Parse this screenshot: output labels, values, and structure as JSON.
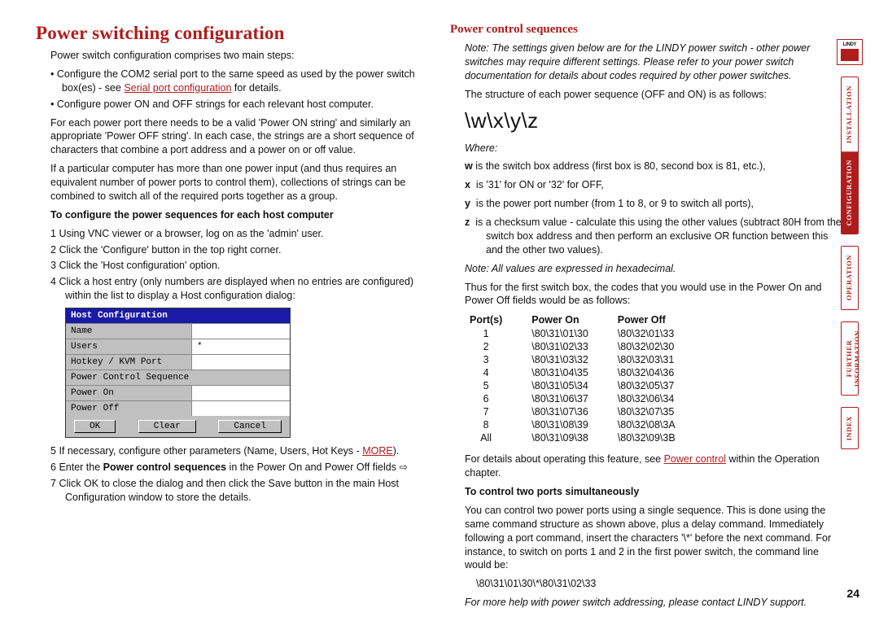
{
  "left": {
    "h1": "Power switching configuration",
    "intro": "Power switch configuration comprises two main steps:",
    "b1a": "Configure the COM2 serial port to the same speed as used by the power switch box(es) - see ",
    "b1_link": "Serial port configuration",
    "b1b": " for details.",
    "b2": "Configure power ON and OFF strings for each relevant host computer.",
    "p1": "For each power port there needs to be a valid 'Power ON string' and similarly an appropriate 'Power OFF string'. In each case, the strings are a short sequence of characters that combine a port address and a power on or off value.",
    "p2": "If a particular computer has more than one power input (and thus requires an equivalent number of power ports to control them), collections of strings can be combined to switch all of the required ports together as a group.",
    "sh1": "To configure the power sequences for each host computer",
    "s1": "Using VNC viewer or a browser, log on as the 'admin' user.",
    "s2": "Click the 'Configure' button in the top right corner.",
    "s3": "Click the 'Host configuration' option.",
    "s4": "Click a host entry (only numbers are displayed when no entries are configured) within the list to display a Host configuration dialog:",
    "dlg": {
      "title": "Host Configuration",
      "r1": "Name",
      "r2": "Users",
      "v2": "*",
      "r3": "Hotkey / KVM Port",
      "r4": "Power Control Sequence",
      "r5": "Power On",
      "r6": "Power Off",
      "ok": "OK",
      "clear": "Clear",
      "cancel": "Cancel"
    },
    "s5a": "If necessary, configure other parameters (Name, Users, Hot Keys - ",
    "s5_link": "MORE",
    "s5b": ").",
    "s6a": "Enter the ",
    "s6_strong": "Power control sequences",
    "s6b": " in the Power On and Power Off fields ⇨",
    "s7": "Click OK to close the dialog and then click the Save button in the main Host Configuration window to store the details."
  },
  "right": {
    "h2": "Power control sequences",
    "note1": "Note: The settings given below are for the LINDY power switch - other power switches may require different settings. Please refer to your power switch documentation for details about codes required by other power switches.",
    "p1": "The structure of each power sequence (OFF and ON) is as follows:",
    "seq": "\\w\\x\\y\\z",
    "where": "Where:",
    "d_w": " is the switch box address (first box is 80, second box is 81, etc.),",
    "d_x": " is '31' for ON or '32' for OFF,",
    "d_y": " is the power port number (from 1 to 8, or 9 to switch all ports),",
    "d_z": " is a checksum value - calculate this using the other values (subtract 80H from the switch box address and then perform an exclusive OR function between this and the other two values).",
    "note2": "Note: All values are expressed in hexadecimal.",
    "p2": "Thus for the first switch box, the codes that you would use in the Power On and Power Off fields would be as follows:",
    "th1": "Port(s)",
    "th2": "Power On",
    "th3": "Power Off",
    "rows": [
      {
        "p": "1",
        "on": "\\80\\31\\01\\30",
        "off": "\\80\\32\\01\\33"
      },
      {
        "p": "2",
        "on": "\\80\\31\\02\\33",
        "off": "\\80\\32\\02\\30"
      },
      {
        "p": "3",
        "on": "\\80\\31\\03\\32",
        "off": "\\80\\32\\03\\31"
      },
      {
        "p": "4",
        "on": "\\80\\31\\04\\35",
        "off": "\\80\\32\\04\\36"
      },
      {
        "p": "5",
        "on": "\\80\\31\\05\\34",
        "off": "\\80\\32\\05\\37"
      },
      {
        "p": "6",
        "on": "\\80\\31\\06\\37",
        "off": "\\80\\32\\06\\34"
      },
      {
        "p": "7",
        "on": "\\80\\31\\07\\36",
        "off": "\\80\\32\\07\\35"
      },
      {
        "p": "8",
        "on": "\\80\\31\\08\\39",
        "off": "\\80\\32\\08\\3A"
      },
      {
        "p": "All",
        "on": "\\80\\31\\09\\38",
        "off": "\\80\\32\\09\\3B"
      }
    ],
    "p3a": "For details about operating this feature, see ",
    "p3_link": "Power control",
    "p3b": " within the Operation chapter.",
    "sh2": "To control two ports simultaneously",
    "p4": "You can control two power ports using a single sequence. This is done using the same command structure as shown above, plus a delay command. Immediately following a port command, insert the characters '\\*' before the next command. For instance, to switch on ports 1 and 2 in the first power switch, the command line would be:",
    "code": "\\80\\31\\01\\30\\*\\80\\31\\02\\33",
    "p5": "For more help with power switch addressing, please contact LINDY support."
  },
  "nav": {
    "g1a": "INSTALLATION",
    "g1b": "CONFIGURATION",
    "g2": "OPERATION",
    "g3": "FURTHER\nINFORMATION",
    "g4": "INDEX"
  },
  "pagenum": "24"
}
